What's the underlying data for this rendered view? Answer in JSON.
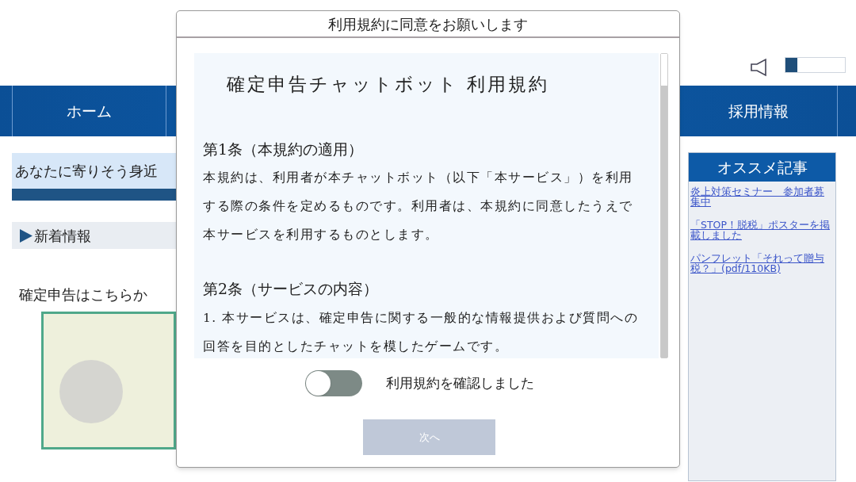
{
  "header": {
    "volume": {
      "level": 0.2
    }
  },
  "nav": {
    "items": [
      {
        "label": "ホーム"
      },
      {
        "label": "採用情報"
      }
    ]
  },
  "main": {
    "banner_text": "あなたに寄りそう身近",
    "news_heading": "新着情報",
    "cta_text": "確定申告はこちらか"
  },
  "sidebar": {
    "title": "オススメ記事",
    "links": [
      "炎上対策セミナー　参加者募集中",
      "「STOP！脱税」ポスターを掲載しました",
      "パンフレット「それって贈与税？」(pdf/110KB)"
    ]
  },
  "dialog": {
    "title": "利用規約に同意をお願いします",
    "document_title": "確定申告チャットボット 利用規約",
    "sections": [
      {
        "heading": "第1条（本規約の適用）",
        "paragraphs": [
          "本規約は、利用者が本チャットボット（以下「本サービス」）を利用する際の条件を定めるものです。利用者は、本規約に同意したうえで本サービスを利用するものとします。"
        ]
      },
      {
        "heading": "第2条（サービスの内容）",
        "paragraphs": [
          "1. 本サービスは、確定申告に関する一般的な情報提供および質問への回答を目的としたチャットを模したゲームです。"
        ]
      }
    ],
    "toggle": {
      "label": "利用規約を確認しました",
      "on": false
    },
    "next_button": {
      "label": "次へ",
      "disabled": true
    }
  }
}
